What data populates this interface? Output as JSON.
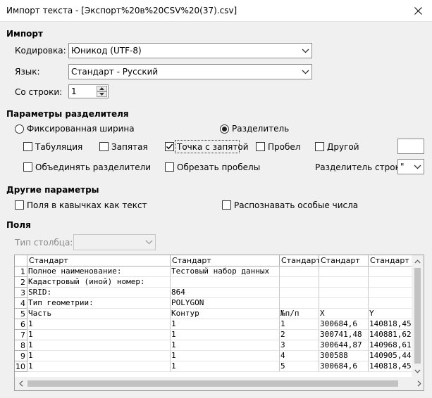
{
  "window": {
    "title": "Импорт текста - [Экспорт%20в%20CSV%20(37).csv]"
  },
  "import": {
    "section_title": "Импорт",
    "charset_label": "Кодировка:",
    "charset_value": "Юникод (UTF-8)",
    "language_label": "Язык:",
    "language_value": "Стандарт - Русский",
    "from_row_label": "Со строки:",
    "from_row_value": "1"
  },
  "separator": {
    "section_title": "Параметры разделителя",
    "fixed_width_label": "Фиксированная ширина",
    "separated_label": "Разделитель",
    "tab_label": "Табуляция",
    "comma_label": "Запятая",
    "semicolon_label": "Точка с запятой",
    "space_label": "Пробел",
    "other_label": "Другой",
    "other_value": "",
    "merge_label": "Объединять разделители",
    "trim_label": "Обрезать пробелы",
    "string_delim_label": "Разделитель строк:",
    "string_delim_value": "\"",
    "checked": {
      "tab": false,
      "comma": false,
      "semicolon": true,
      "space": false,
      "other": false,
      "merge": false,
      "trim": false
    },
    "mode": "separated"
  },
  "other_options": {
    "section_title": "Другие параметры",
    "quoted_as_text_label": "Поля в кавычках как текст",
    "detect_special_label": "Распознавать особые числа"
  },
  "fields": {
    "section_title": "Поля",
    "column_type_label": "Тип столбца:",
    "column_type_value": ""
  },
  "preview": {
    "headers": [
      "Стандарт",
      "Стандарт",
      "Стандарт",
      "Стандарт",
      "Стандарт"
    ],
    "rows": [
      {
        "n": "1",
        "cells": [
          "Полное наименование:",
          "Тестовый набор данных",
          "",
          "",
          ""
        ]
      },
      {
        "n": "2",
        "cells": [
          "Кадастровый (иной) номер:",
          "",
          "",
          "",
          ""
        ]
      },
      {
        "n": "3",
        "cells": [
          "SRID:",
          "864",
          "",
          "",
          ""
        ]
      },
      {
        "n": "4",
        "cells": [
          "Тип геометрии:",
          "POLYGON",
          "",
          "",
          ""
        ]
      },
      {
        "n": "5",
        "cells": [
          "Часть",
          "Контур",
          "№п/п",
          "X",
          "Y"
        ]
      },
      {
        "n": "6",
        "cells": [
          "1",
          "1",
          "1",
          "300684,6",
          "140818,45"
        ]
      },
      {
        "n": "7",
        "cells": [
          "1",
          "1",
          "2",
          "300741,48",
          "140881,62"
        ]
      },
      {
        "n": "8",
        "cells": [
          "1",
          "1",
          "3",
          "300644,87",
          "140968,61"
        ]
      },
      {
        "n": "9",
        "cells": [
          "1",
          "1",
          "4",
          "300588",
          "140905,44"
        ]
      },
      {
        "n": "10",
        "cells": [
          "1",
          "1",
          "5",
          "300684,6",
          "140818,45"
        ]
      }
    ]
  },
  "icons": {
    "close": "close-icon",
    "dropdown": "chevron-down-icon",
    "spin_up": "spin-up-icon",
    "spin_down": "spin-down-icon"
  }
}
